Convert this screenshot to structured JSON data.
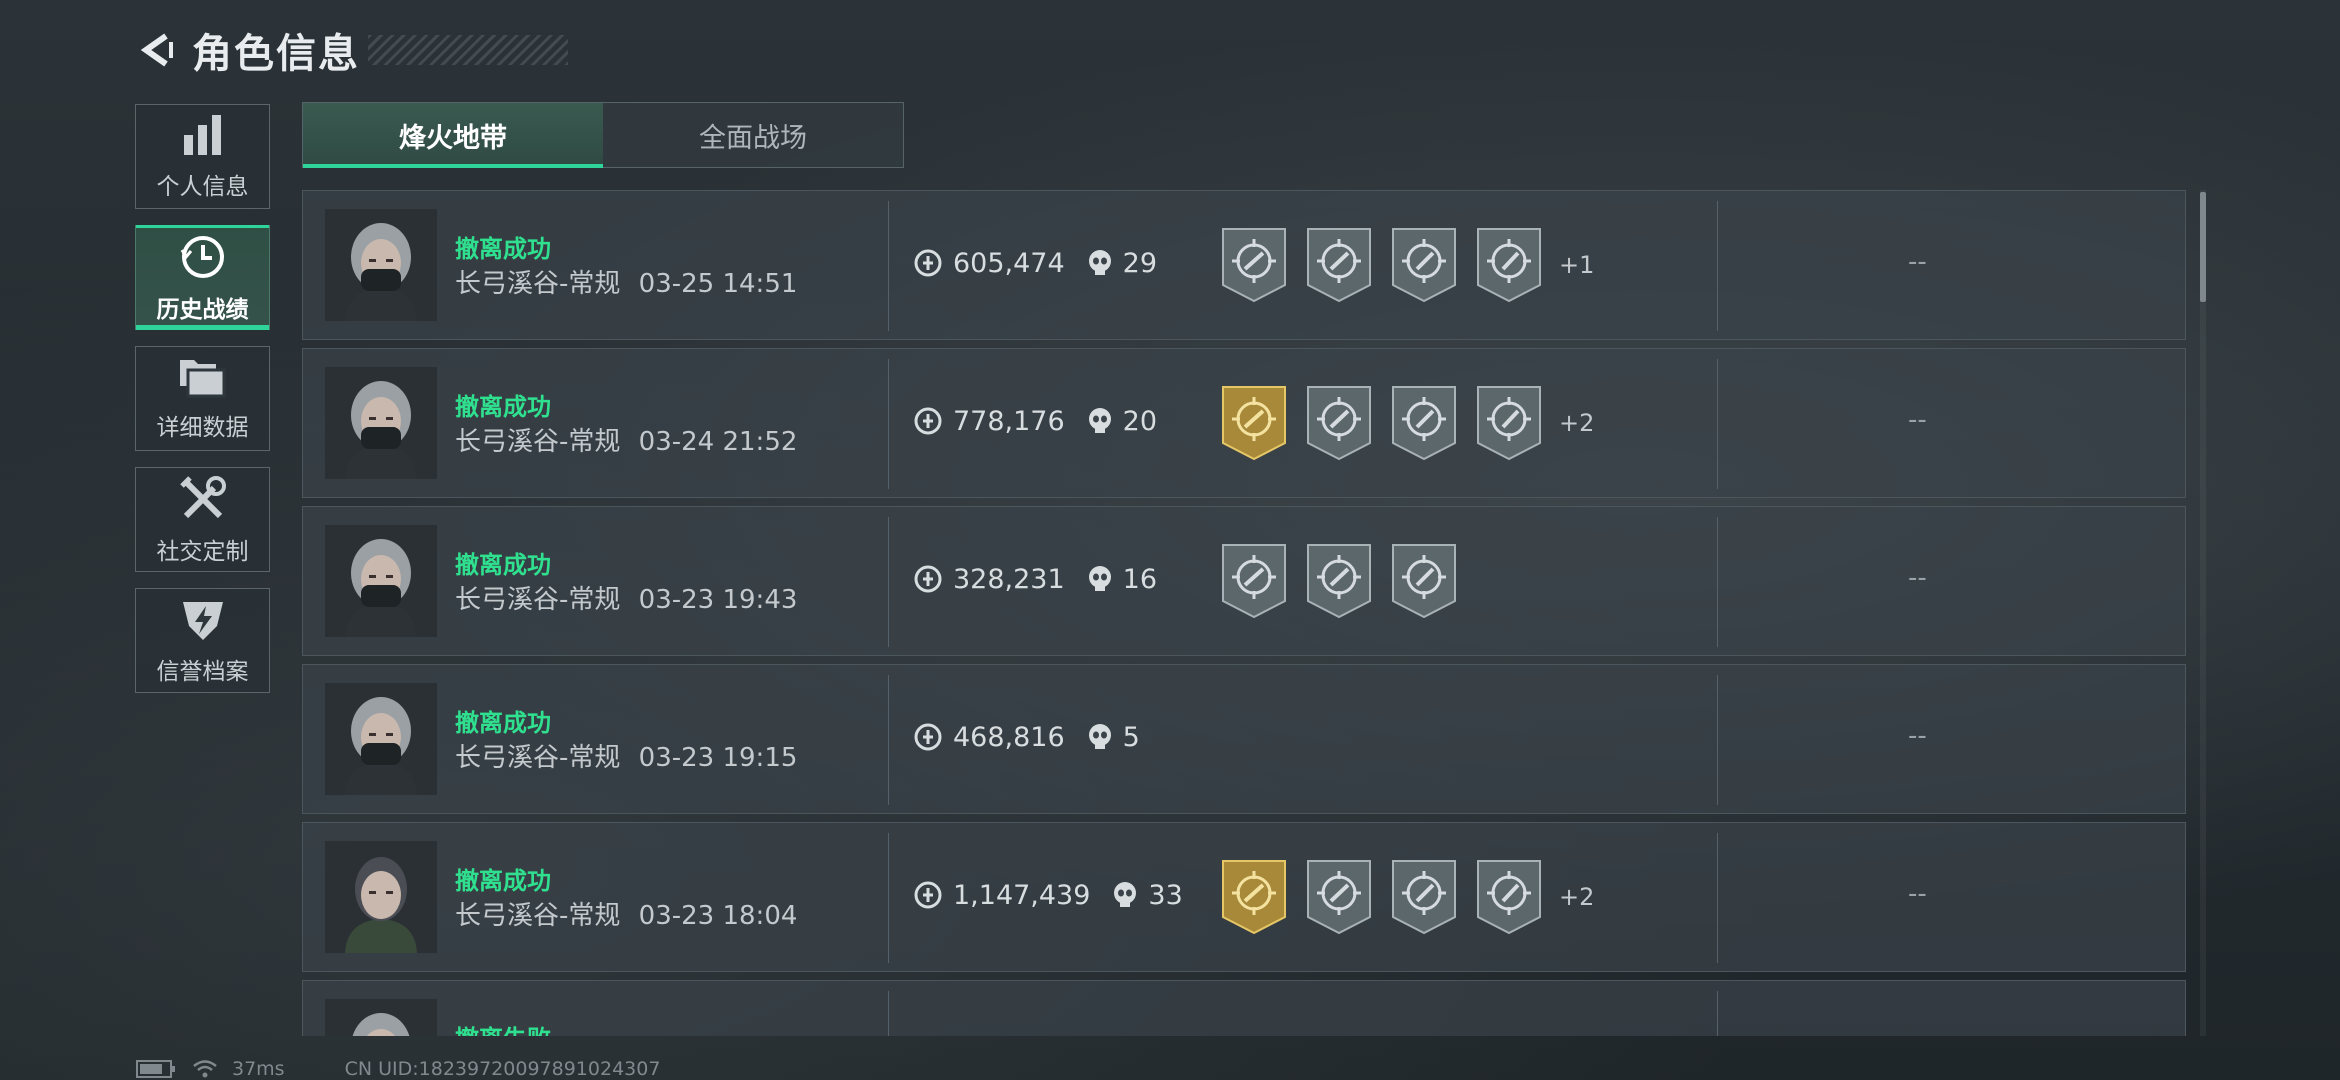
{
  "header": {
    "title": "角色信息"
  },
  "sidebar": {
    "items": [
      {
        "label": "个人信息",
        "icon": "bar-chart-icon"
      },
      {
        "label": "历史战绩",
        "icon": "clock-history-icon"
      },
      {
        "label": "详细数据",
        "icon": "folders-icon"
      },
      {
        "label": "社交定制",
        "icon": "tools-icon"
      },
      {
        "label": "信誉档案",
        "icon": "shield-bolt-icon"
      }
    ]
  },
  "tabs": [
    {
      "label": "烽火地带"
    },
    {
      "label": "全面战场"
    }
  ],
  "records": [
    {
      "status": "撤离成功",
      "map": "长弓溪谷-常规",
      "time": "03-25 14:51",
      "value": "605,474",
      "kills": "29",
      "badges": [
        "gray",
        "gray",
        "gray",
        "gray"
      ],
      "more": "+1",
      "extra": "--"
    },
    {
      "status": "撤离成功",
      "map": "长弓溪谷-常规",
      "time": "03-24 21:52",
      "value": "778,176",
      "kills": "20",
      "badges": [
        "gold",
        "gray",
        "gray",
        "gray"
      ],
      "more": "+2",
      "extra": "--"
    },
    {
      "status": "撤离成功",
      "map": "长弓溪谷-常规",
      "time": "03-23 19:43",
      "value": "328,231",
      "kills": "16",
      "badges": [
        "gray",
        "gray",
        "gray"
      ],
      "more": "",
      "extra": "--"
    },
    {
      "status": "撤离成功",
      "map": "长弓溪谷-常规",
      "time": "03-23 19:15",
      "value": "468,816",
      "kills": "5",
      "badges": [],
      "more": "",
      "extra": "--"
    },
    {
      "status": "撤离成功",
      "map": "长弓溪谷-常规",
      "time": "03-23 18:04",
      "value": "1,147,439",
      "kills": "33",
      "badges": [
        "gold",
        "gray",
        "gray",
        "gray"
      ],
      "more": "+2",
      "extra": "--"
    },
    {
      "status": "撤离失败",
      "map": "",
      "time": "",
      "value": "",
      "kills": "",
      "badges": [],
      "more": "",
      "extra": ""
    }
  ],
  "footer": {
    "ping": "37ms",
    "uid": "CN UID:18239720097891024307"
  }
}
